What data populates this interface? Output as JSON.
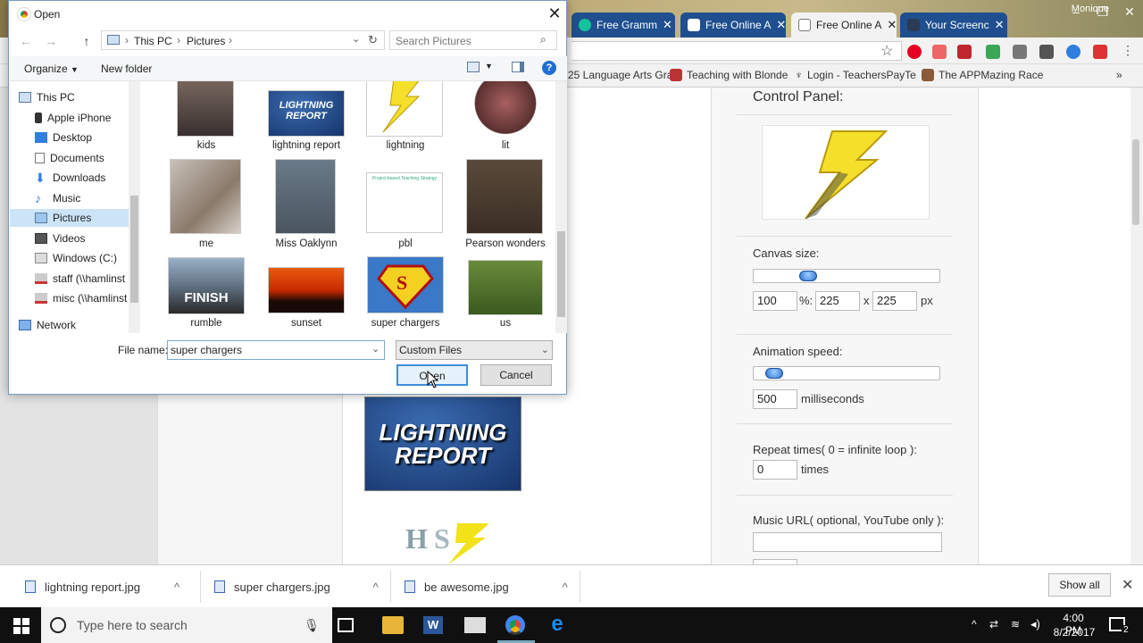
{
  "browser": {
    "profile": "Monique",
    "tabs": [
      {
        "label": "Free Gramm",
        "icon": "grammarly-icon"
      },
      {
        "label": "Free Online A",
        "icon": "page-icon"
      },
      {
        "label": "Free Online A",
        "icon": "document-icon"
      },
      {
        "label": "Your Screenc",
        "icon": "screencast-icon"
      }
    ],
    "bookmarks": [
      "25 Language Arts Gra",
      "Teaching with Blonde",
      "Login - TeachersPayTe",
      "The APPMazing Race"
    ]
  },
  "panel": {
    "title": "Control Panel:",
    "canvas_label": "Canvas size:",
    "canvas_slider_level": 0.25,
    "canvas_percent": "100",
    "percent_suffix": "%:",
    "width": "225",
    "x_sep": "x",
    "height": "225",
    "px": "px",
    "speed_label": "Animation speed:",
    "speed_slider_level": 0.05,
    "speed_value": "500",
    "speed_unit": "milliseconds",
    "repeat_label": "Repeat times( 0 = infinite loop ):",
    "repeat_value": "0",
    "repeat_unit": "times",
    "music_label": "Music URL( optional, YouTube only ):",
    "music_value": ""
  },
  "page_images": {
    "lightning_banner": "LIGHTNING REPORT"
  },
  "dialog": {
    "title": "Open",
    "breadcrumb": [
      "This PC",
      "Pictures"
    ],
    "search_placeholder": "Search Pictures",
    "organize": "Organize",
    "new_folder": "New folder",
    "nav": [
      {
        "label": "This PC",
        "icon": "pc-icon"
      },
      {
        "label": "Apple iPhone",
        "icon": "phone-icon"
      },
      {
        "label": "Desktop",
        "icon": "desktop-icon"
      },
      {
        "label": "Documents",
        "icon": "documents-icon"
      },
      {
        "label": "Downloads",
        "icon": "downloads-icon"
      },
      {
        "label": "Music",
        "icon": "music-icon"
      },
      {
        "label": "Pictures",
        "icon": "pictures-icon"
      },
      {
        "label": "Videos",
        "icon": "videos-icon"
      },
      {
        "label": "Windows (C:)",
        "icon": "drive-icon"
      },
      {
        "label": "staff (\\\\hamlinst",
        "icon": "network-drive-icon"
      },
      {
        "label": "misc (\\\\hamlinst",
        "icon": "network-drive-icon"
      },
      {
        "label": "Network",
        "icon": "network-icon"
      }
    ],
    "files": [
      {
        "name": "kids"
      },
      {
        "name": "lightning report"
      },
      {
        "name": "lightning"
      },
      {
        "name": "lit"
      },
      {
        "name": "me"
      },
      {
        "name": "Miss Oaklynn"
      },
      {
        "name": "pbl"
      },
      {
        "name": "Pearson wonders"
      },
      {
        "name": "rumble"
      },
      {
        "name": "sunset"
      },
      {
        "name": "super chargers"
      },
      {
        "name": "us"
      }
    ],
    "thumb_text": {
      "lightning_report": "LIGHTNING REPORT",
      "rumble": "FINISH",
      "pbl": "Project-based Teaching Strategy"
    },
    "filename_label": "File name:",
    "filename_value": "super chargers",
    "filter_value": "Custom Files",
    "open_button": "Open",
    "cancel_button": "Cancel"
  },
  "downloads": {
    "items": [
      "lightning report.jpg",
      "super chargers.jpg",
      "be awesome.jpg"
    ],
    "show_all": "Show all"
  },
  "taskbar": {
    "search_placeholder": "Type here to search",
    "time": "4:00 PM",
    "date": "8/2/2017",
    "notifications": "2"
  }
}
